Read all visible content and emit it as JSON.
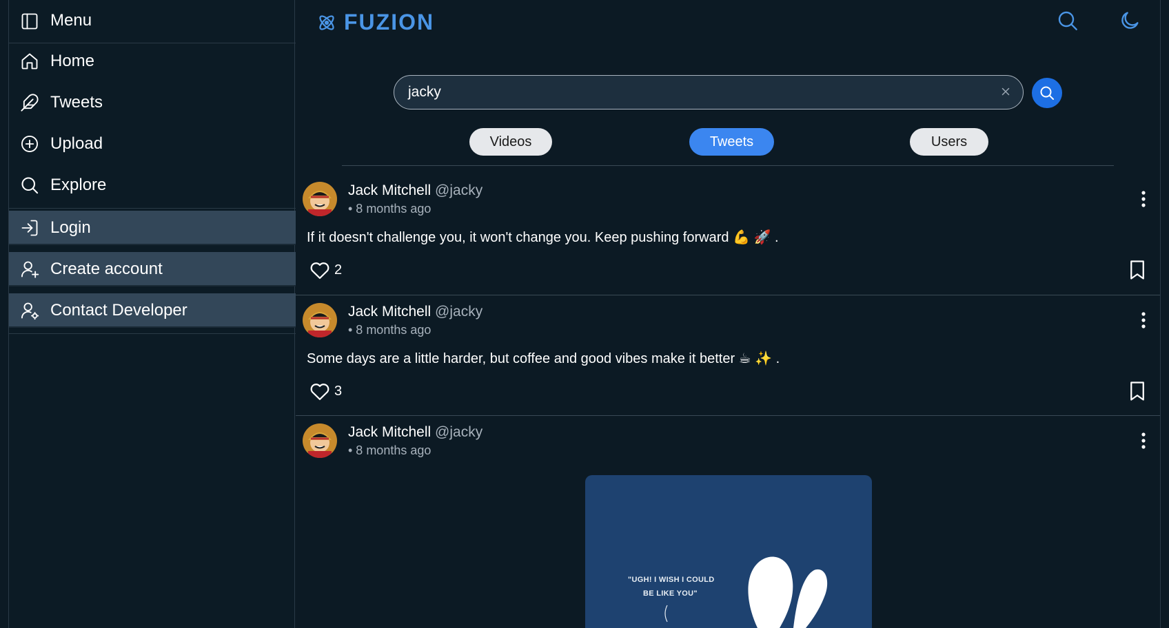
{
  "sidebar": {
    "menu_label": "Menu",
    "items": [
      {
        "label": "Home",
        "icon": "home-icon"
      },
      {
        "label": "Tweets",
        "icon": "feather-icon"
      },
      {
        "label": "Upload",
        "icon": "plus-circle-icon"
      },
      {
        "label": "Explore",
        "icon": "search-icon"
      }
    ],
    "auth_items": [
      {
        "label": "Login",
        "icon": "login-icon"
      },
      {
        "label": "Create account",
        "icon": "user-plus-icon"
      },
      {
        "label": "Contact Developer",
        "icon": "user-gear-icon"
      }
    ]
  },
  "header": {
    "brand": "FUZION",
    "icons": [
      "search-icon",
      "moon-icon"
    ]
  },
  "search": {
    "value": "jacky"
  },
  "tabs": [
    {
      "label": "Videos",
      "active": false
    },
    {
      "label": "Tweets",
      "active": true
    },
    {
      "label": "Users",
      "active": false
    }
  ],
  "tweets": [
    {
      "name": "Jack Mitchell",
      "handle": "@jacky",
      "time": "• 8 months ago",
      "text": "If it doesn't challenge you, it won't change you. Keep pushing forward 💪 🚀 .",
      "likes": "2"
    },
    {
      "name": "Jack Mitchell",
      "handle": "@jacky",
      "time": "• 8 months ago",
      "text": "Some days are a little harder, but coffee and good vibes make it better ☕ ✨ .",
      "likes": "3"
    },
    {
      "name": "Jack Mitchell",
      "handle": "@jacky",
      "time": "• 8 months ago",
      "image_caption_line1": "\"UGH! I WISH I COULD",
      "image_caption_line2": "BE LIKE YOU\""
    }
  ],
  "colors": {
    "background": "#0c1a24",
    "accent": "#3b86f0",
    "brand": "#4a95e6",
    "search_button": "#1d6fe4",
    "sidebar_box": "#334759"
  }
}
